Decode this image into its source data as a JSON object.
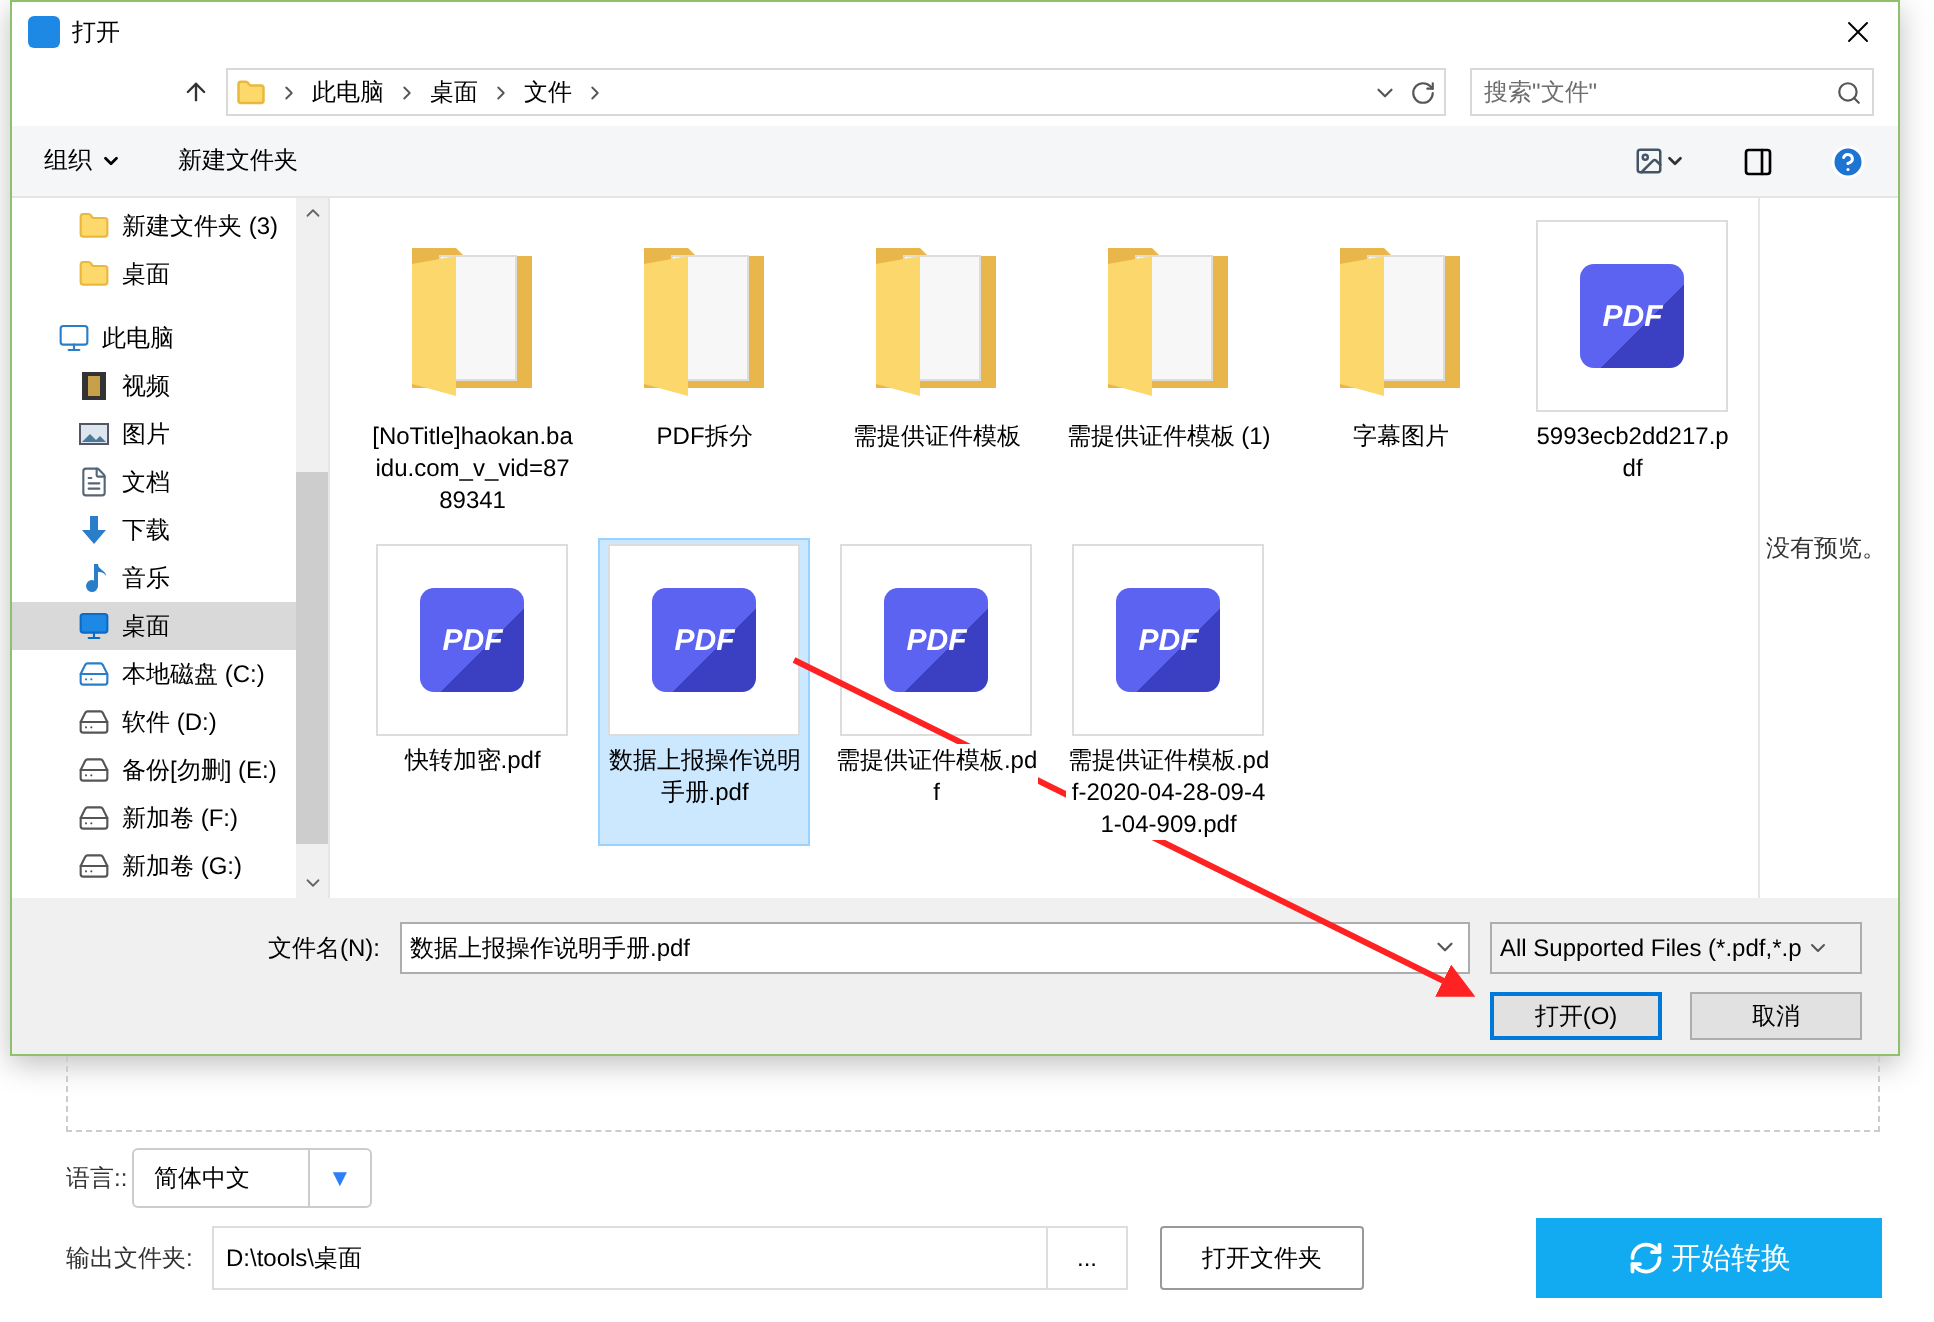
{
  "window": {
    "title": "打开"
  },
  "address": {
    "crumbs": [
      "此电脑",
      "桌面",
      "文件"
    ],
    "search_placeholder": "搜索\"文件\""
  },
  "toolbar": {
    "organize": "组织",
    "new_folder": "新建文件夹"
  },
  "nav": {
    "items": [
      {
        "label": "新建文件夹 (3)",
        "kind": "folder",
        "selected": false
      },
      {
        "label": "桌面",
        "kind": "folder",
        "selected": false
      },
      {
        "label": "此电脑",
        "kind": "computer",
        "selected": false,
        "children": [
          {
            "label": "视频",
            "kind": "video",
            "selected": false
          },
          {
            "label": "图片",
            "kind": "picture",
            "selected": false
          },
          {
            "label": "文档",
            "kind": "document",
            "selected": false
          },
          {
            "label": "下载",
            "kind": "download",
            "selected": false
          },
          {
            "label": "音乐",
            "kind": "music",
            "selected": false
          },
          {
            "label": "桌面",
            "kind": "desktop",
            "selected": true
          },
          {
            "label": "本地磁盘 (C:)",
            "kind": "systemdrive",
            "selected": false
          },
          {
            "label": "软件 (D:)",
            "kind": "drive",
            "selected": false
          },
          {
            "label": "备份[勿删] (E:)",
            "kind": "drive",
            "selected": false
          },
          {
            "label": "新加卷 (F:)",
            "kind": "drive",
            "selected": false
          },
          {
            "label": "新加卷 (G:)",
            "kind": "drive",
            "selected": false
          }
        ]
      }
    ]
  },
  "files": [
    {
      "name": "[NoTitle]haokan.baidu.com_v_vid=8789341",
      "kind": "folder",
      "selected": false
    },
    {
      "name": "PDF拆分",
      "kind": "folder",
      "selected": false
    },
    {
      "name": "需提供证件模板",
      "kind": "folder",
      "selected": false
    },
    {
      "name": "需提供证件模板 (1)",
      "kind": "folder",
      "selected": false
    },
    {
      "name": "字幕图片",
      "kind": "folder",
      "selected": false
    },
    {
      "name": "5993ecb2dd217.pdf",
      "kind": "pdf",
      "icon_label": "PDF",
      "selected": false
    },
    {
      "name": "快转加密.pdf",
      "kind": "pdf",
      "icon_label": "PDF",
      "selected": false
    },
    {
      "name": "数据上报操作说明手册.pdf",
      "kind": "pdf",
      "icon_label": "PDF",
      "selected": true
    },
    {
      "name": "需提供证件模板.pdf",
      "kind": "pdf",
      "icon_label": "PDF",
      "selected": false
    },
    {
      "name": "需提供证件模板.pdf-2020-04-28-09-41-04-909.pdf",
      "kind": "pdf",
      "icon_label": "PDF",
      "selected": false
    }
  ],
  "preview": {
    "message": "没有预览。"
  },
  "footer": {
    "filename_label": "文件名(N):",
    "filename": "数据上报操作说明手册.pdf",
    "filetype": "All Supported Files (*.pdf,*.p",
    "open": "打开(O)",
    "cancel": "取消"
  },
  "app": {
    "language_label": "语言::",
    "language": "简体中文",
    "language_arrow": "▼",
    "output_label": "输出文件夹:",
    "output_path": "D:\\tools\\桌面",
    "browse": "...",
    "open_folder": "打开文件夹",
    "start": "开始转换"
  }
}
